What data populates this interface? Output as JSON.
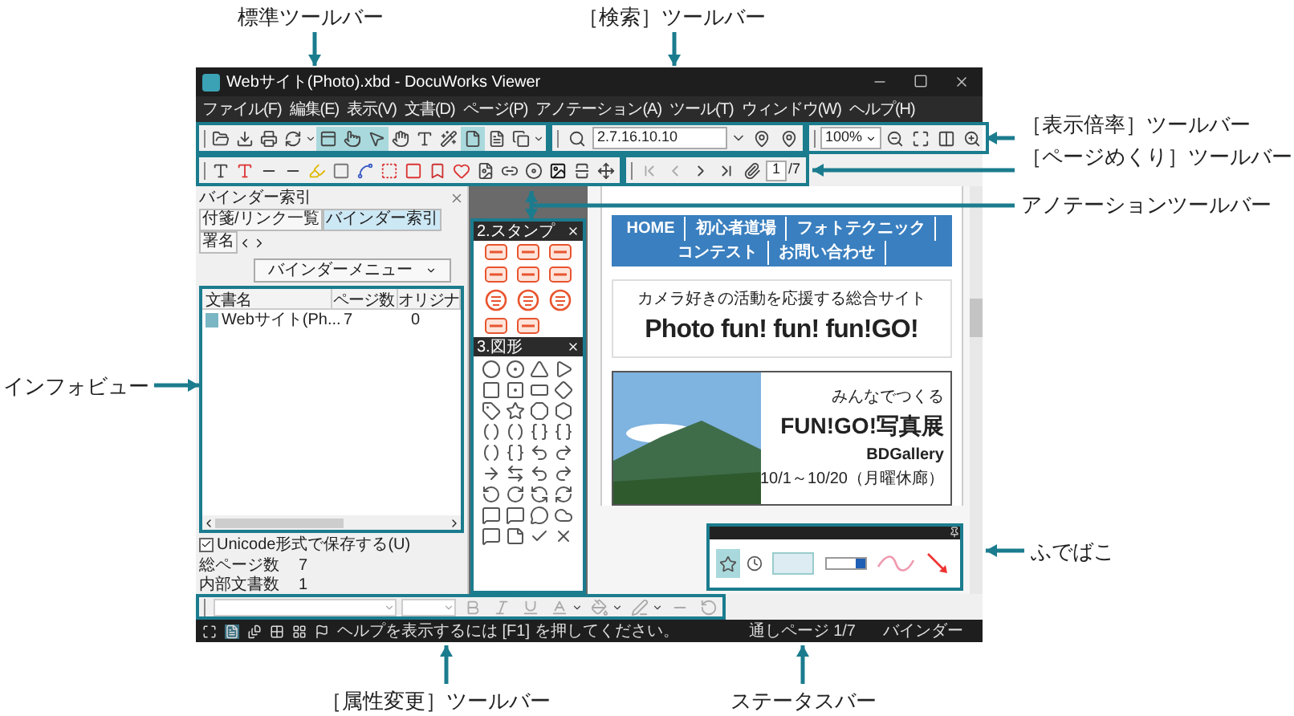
{
  "window": {
    "title": "Webサイト(Photo).xbd - DocuWorks Viewer"
  },
  "menu": [
    "ファイル(F)",
    "編集(E)",
    "表示(V)",
    "文書(D)",
    "ページ(P)",
    "アノテーション(A)",
    "ツール(T)",
    "ウィンドウ(W)",
    "ヘルプ(H)"
  ],
  "standard_toolbar": {
    "buttons": [
      {
        "on": false
      },
      {
        "on": false
      },
      {
        "on": false
      },
      {
        "on": false
      },
      {
        "on": true
      },
      {
        "on": true
      },
      {
        "on": true
      },
      {
        "on": false
      },
      {
        "on": false
      },
      {
        "on": false
      },
      {
        "on": true
      },
      {
        "on": false
      },
      {
        "on": false
      }
    ]
  },
  "search_toolbar": {
    "value": "2.7.16.10.10"
  },
  "zoom_toolbar": {
    "value": "100%"
  },
  "page_toolbar": {
    "page": "1",
    "total": "/7"
  },
  "left_pane": {
    "title": "バインダー索引",
    "tabs": [
      {
        "label": "付箋/リンク一覧",
        "selected": false
      },
      {
        "label": "バインダー索引",
        "selected": true
      },
      {
        "label": "署名",
        "selected": false
      }
    ],
    "menu_button": "バインダーメニュー",
    "columns": [
      "文書名",
      "ページ数",
      "オリジナ"
    ],
    "rows": [
      {
        "cells": [
          "Webサイト(Ph...",
          "7",
          "0"
        ]
      }
    ],
    "save_option": {
      "label": "Unicode形式で保存する(U)",
      "checked": true
    },
    "stats": [
      {
        "label": "総ページ数",
        "value": "7"
      },
      {
        "label": "内部文書数",
        "value": "1"
      }
    ]
  },
  "stamp_palette": {
    "title": "2.スタンプ"
  },
  "shape_palette": {
    "title": "3.図形"
  },
  "document": {
    "nav": [
      "HOME",
      "初心者道場",
      "フォトテクニック",
      "コンテスト",
      "お問い合わせ"
    ],
    "tagline": "カメラ好きの活動を応援する総合サイト",
    "headline": "Photo fun! fun! fun!GO!",
    "event": {
      "lead": "みんなでつくる",
      "title": "FUN!GO!写真展",
      "gallery": "BDGallery",
      "dates": "10/1～10/20（月曜休廊）"
    }
  },
  "fudebako": {
    "tools": [
      {
        "selected": true
      },
      {
        "selected": false
      },
      {
        "selected": false
      },
      {
        "selected": false
      },
      {
        "selected": false
      },
      {
        "selected": false
      }
    ]
  },
  "status_bar": {
    "help": "ヘルプを表示するには [F1] を押してください。",
    "page": "通しページ 1/7",
    "mode": "バインダー"
  },
  "callouts": {
    "standard": "標準ツールバー",
    "search": "［検索］ツールバー",
    "zoom": "［表示倍率］ツールバー",
    "page": "［ページめくり］ツールバー",
    "annotation": "アノテーションツールバー",
    "info": "インフォビュー",
    "fudebako": "ふでばこ",
    "attribute": "［属性変更］ツールバー",
    "status": "ステータスバー"
  }
}
